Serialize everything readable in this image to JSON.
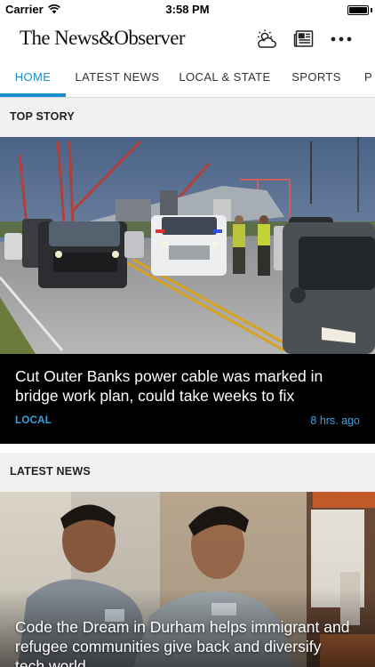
{
  "status_bar": {
    "carrier": "Carrier",
    "time": "3:58 PM",
    "wifi_icon": "wifi-icon",
    "battery_icon": "battery-icon"
  },
  "header": {
    "masthead": "The News&Observer",
    "icons": [
      "weather-icon",
      "epaper-icon",
      "more-icon"
    ]
  },
  "nav": {
    "tabs": [
      "HOME",
      "LATEST NEWS",
      "LOCAL & STATE",
      "SPORTS",
      "P"
    ],
    "active_tab": "HOME",
    "accent_color": "#1a8fd0"
  },
  "top_story": {
    "section_label": "TOP STORY",
    "title": "Cut Outer Banks power cable was marked in bridge work plan, could take weeks to fix",
    "category": "LOCAL",
    "time": "8 hrs. ago"
  },
  "latest_news": {
    "section_label": "LATEST NEWS",
    "title": "Code the Dream in Durham helps immigrant and refugee communities give back and diversify tech world"
  }
}
